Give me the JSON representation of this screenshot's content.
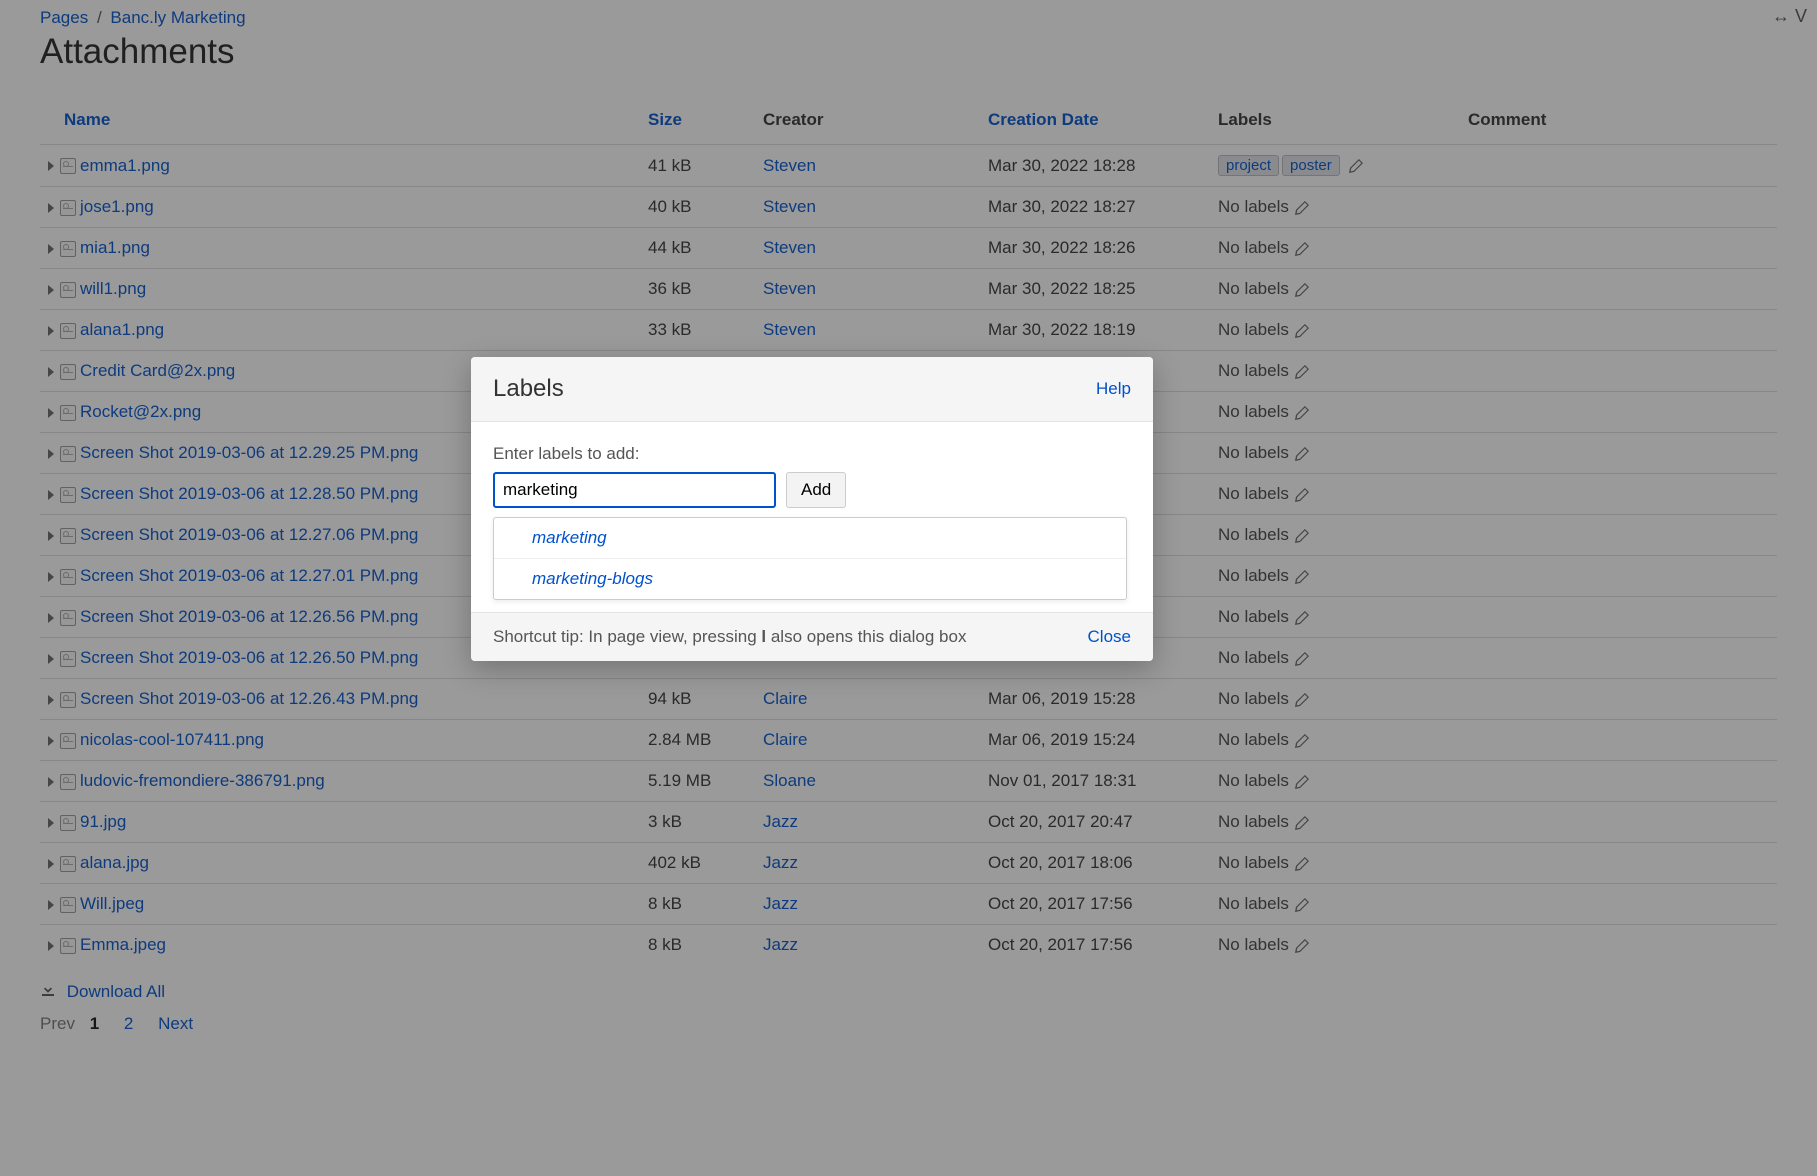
{
  "breadcrumb": {
    "root": "Pages",
    "sep": "/",
    "space": "Banc.ly Marketing"
  },
  "title": "Attachments",
  "top_right": "↔ V",
  "columns": {
    "name": "Name",
    "size": "Size",
    "creator": "Creator",
    "date": "Creation Date",
    "labels": "Labels",
    "comment": "Comment"
  },
  "no_labels_text": "No labels",
  "rows": [
    {
      "name": "emma1.png",
      "size": "41 kB",
      "creator": "Steven",
      "date": "Mar 30, 2022 18:28",
      "labels": [
        "project",
        "poster"
      ]
    },
    {
      "name": "jose1.png",
      "size": "40 kB",
      "creator": "Steven",
      "date": "Mar 30, 2022 18:27",
      "labels": []
    },
    {
      "name": "mia1.png",
      "size": "44 kB",
      "creator": "Steven",
      "date": "Mar 30, 2022 18:26",
      "labels": []
    },
    {
      "name": "will1.png",
      "size": "36 kB",
      "creator": "Steven",
      "date": "Mar 30, 2022 18:25",
      "labels": []
    },
    {
      "name": "alana1.png",
      "size": "33 kB",
      "creator": "Steven",
      "date": "Mar 30, 2022 18:19",
      "labels": []
    },
    {
      "name": "Credit Card@2x.png",
      "size": "",
      "creator": "",
      "date": "",
      "labels": []
    },
    {
      "name": "Rocket@2x.png",
      "size": "",
      "creator": "",
      "date": "",
      "labels": []
    },
    {
      "name": "Screen Shot 2019-03-06 at 12.29.25 PM.png",
      "size": "",
      "creator": "",
      "date": "",
      "labels": []
    },
    {
      "name": "Screen Shot 2019-03-06 at 12.28.50 PM.png",
      "size": "",
      "creator": "",
      "date": "",
      "labels": []
    },
    {
      "name": "Screen Shot 2019-03-06 at 12.27.06 PM.png",
      "size": "",
      "creator": "",
      "date": "",
      "labels": []
    },
    {
      "name": "Screen Shot 2019-03-06 at 12.27.01 PM.png",
      "size": "",
      "creator": "",
      "date": "",
      "labels": []
    },
    {
      "name": "Screen Shot 2019-03-06 at 12.26.56 PM.png",
      "size": "",
      "creator": "",
      "date": "",
      "labels": []
    },
    {
      "name": "Screen Shot 2019-03-06 at 12.26.50 PM.png",
      "size": "",
      "creator": "",
      "date": "",
      "labels": []
    },
    {
      "name": "Screen Shot 2019-03-06 at 12.26.43 PM.png",
      "size": "94 kB",
      "creator": "Claire",
      "date": "Mar 06, 2019 15:28",
      "labels": []
    },
    {
      "name": "nicolas-cool-107411.png",
      "size": "2.84 MB",
      "creator": "Claire",
      "date": "Mar 06, 2019 15:24",
      "labels": []
    },
    {
      "name": "ludovic-fremondiere-386791.png",
      "size": "5.19 MB",
      "creator": "Sloane",
      "date": "Nov 01, 2017 18:31",
      "labels": []
    },
    {
      "name": "91.jpg",
      "size": "3 kB",
      "creator": "Jazz",
      "date": "Oct 20, 2017 20:47",
      "labels": []
    },
    {
      "name": "alana.jpg",
      "size": "402 kB",
      "creator": "Jazz",
      "date": "Oct 20, 2017 18:06",
      "labels": []
    },
    {
      "name": "Will.jpeg",
      "size": "8 kB",
      "creator": "Jazz",
      "date": "Oct 20, 2017 17:56",
      "labels": []
    },
    {
      "name": "Emma.jpeg",
      "size": "8 kB",
      "creator": "Jazz",
      "date": "Oct 20, 2017 17:56",
      "labels": []
    }
  ],
  "download_all": "Download All",
  "pagination": {
    "prev": "Prev",
    "current": "1",
    "page2": "2",
    "next": "Next"
  },
  "dialog": {
    "title": "Labels",
    "help": "Help",
    "prompt": "Enter labels to add:",
    "input_value": "marketing",
    "add": "Add",
    "suggestions": [
      "marketing",
      "marketing-blogs"
    ],
    "tip_prefix": "Shortcut tip: In page view, pressing ",
    "tip_key": "l",
    "tip_suffix": " also opens this dialog box",
    "close": "Close"
  }
}
